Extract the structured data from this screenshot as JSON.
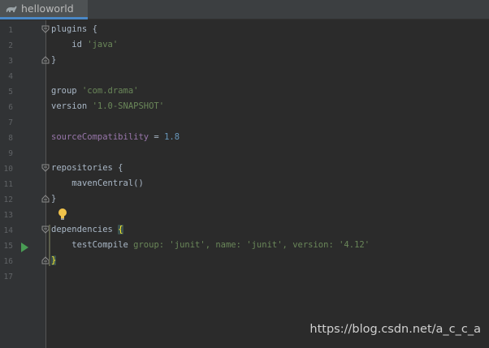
{
  "tab": {
    "title": "helloworld",
    "icon": "gradle-elephant-icon"
  },
  "line_numbers": [
    "1",
    "2",
    "3",
    "4",
    "5",
    "6",
    "7",
    "8",
    "9",
    "10",
    "11",
    "12",
    "13",
    "14",
    "15",
    "16",
    "17"
  ],
  "code": {
    "l1": {
      "t": "plugins {"
    },
    "l2": {
      "t1": "id ",
      "s1": "'java'"
    },
    "l3": {
      "t": "}"
    },
    "l5": {
      "t1": "group ",
      "s1": "'com.drama'"
    },
    "l6": {
      "t1": "version ",
      "s1": "'1.0-SNAPSHOT'"
    },
    "l8": {
      "p1": "sourceCompatibility",
      "t1": " = ",
      "n1": "1.8"
    },
    "l10": {
      "t": "repositories {"
    },
    "l11": {
      "t": "mavenCentral()"
    },
    "l12": {
      "t": "}"
    },
    "l14": {
      "t1": "dependencies ",
      "b1": "{"
    },
    "l15": {
      "t1": "testCompile ",
      "k1": "group: ",
      "s1": "'junit'",
      "c1": ", ",
      "k2": "name: ",
      "s2": "'junit'",
      "c2": ", ",
      "k3": "version: ",
      "s3": "'4.12'"
    },
    "l16": {
      "b1": "}"
    }
  },
  "watermark": "https://blog.csdn.net/a_c_c_a",
  "colors": {
    "background": "#2b2b2b",
    "string": "#6a8759",
    "property": "#9876aa",
    "number": "#6897bb",
    "text": "#a9b7c6",
    "tab_accent": "#4a88c7",
    "run": "#499c54"
  }
}
